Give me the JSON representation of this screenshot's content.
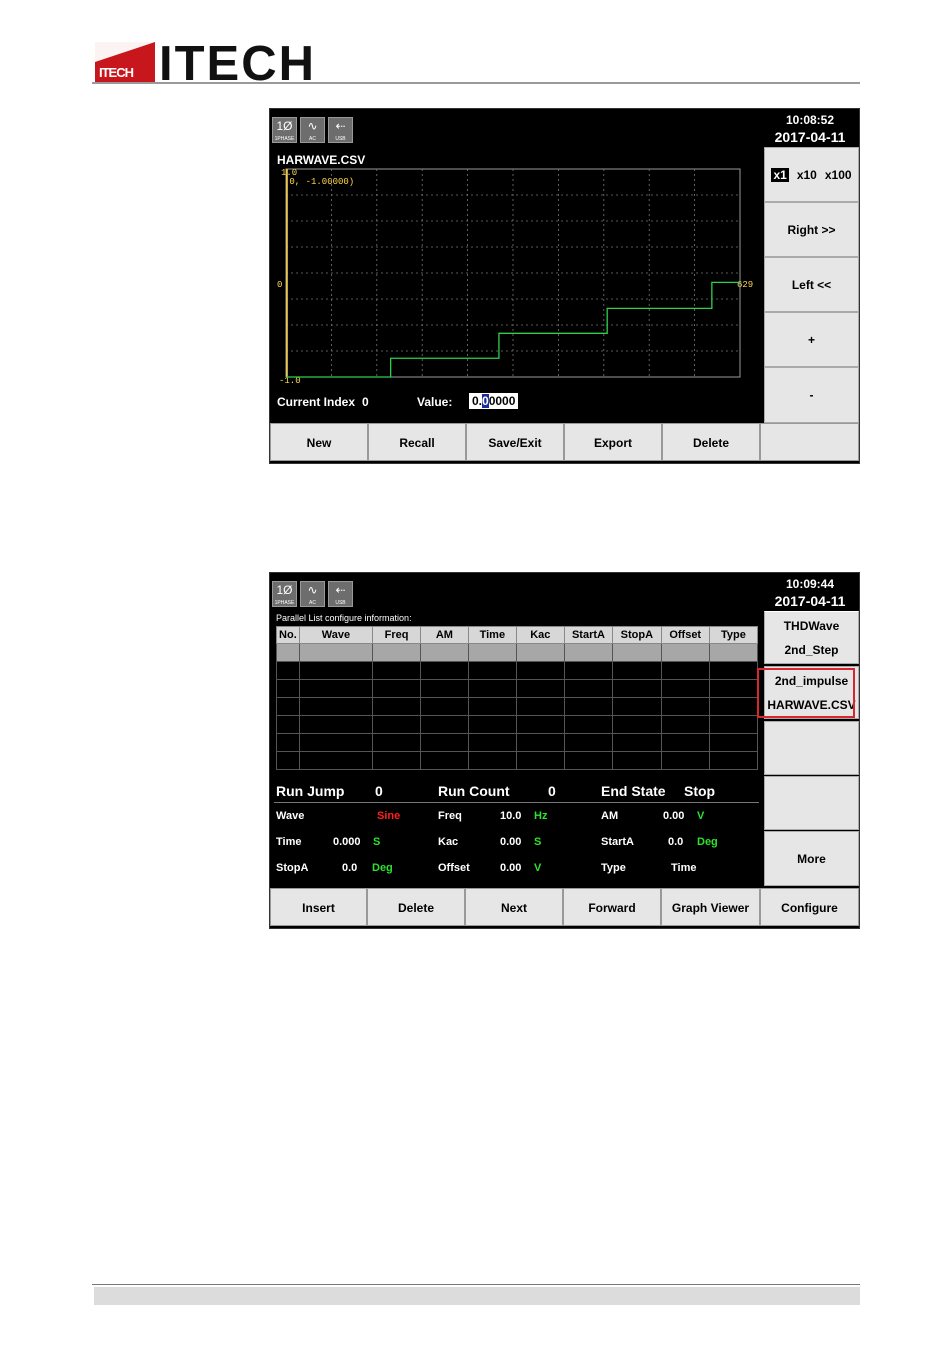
{
  "logo": {
    "small": "ITECH",
    "text": "ITECH"
  },
  "screen1": {
    "icons": [
      {
        "name": "phase-icon",
        "glyph": "1Ø",
        "caption": "1PHASE"
      },
      {
        "name": "ac-wave-icon",
        "glyph": "∿",
        "caption": "AC"
      },
      {
        "name": "usb-icon",
        "glyph": "⇠",
        "caption": "USB"
      }
    ],
    "time": "10:08:52",
    "date": "2017-04-11",
    "file_title": "HARWAVE.CSV",
    "y_top": "1.0",
    "y_mid": "0",
    "y_bottom": "-1.0",
    "cursor_readout": "(0, -1.00000)",
    "x_end_label": "629",
    "current_index_label": "Current Index",
    "current_index_value": "0",
    "value_label": "Value:",
    "value_pre": "0.",
    "value_cursor": "0",
    "value_post": "0000",
    "zoom": {
      "x1": "x1",
      "x10": "x10",
      "x100": "x100"
    },
    "side_buttons": [
      "Right >>",
      "Left <<",
      "+",
      "-"
    ],
    "bottom_buttons": [
      "New",
      "Recall",
      "Save/Exit",
      "Export",
      "Delete",
      ""
    ],
    "chart_data": {
      "type": "line",
      "x": [
        0,
        145,
        145,
        295,
        295,
        445,
        445,
        590,
        590,
        629
      ],
      "y": [
        -1.0,
        -1.0,
        -0.82,
        -0.82,
        -0.58,
        -0.58,
        -0.34,
        -0.34,
        -0.09,
        -0.09
      ],
      "xlim": [
        0,
        629
      ],
      "ylim": [
        -1.0,
        1.0
      ],
      "grid": true,
      "line_color": "#2fcf4a"
    }
  },
  "screen2": {
    "icons": [
      {
        "name": "phase-icon",
        "glyph": "1Ø",
        "caption": "1PHASE"
      },
      {
        "name": "ac-wave-icon",
        "glyph": "∿",
        "caption": "AC"
      },
      {
        "name": "usb-icon",
        "glyph": "⇠",
        "caption": "USB"
      }
    ],
    "time": "10:09:44",
    "date": "2017-04-11",
    "table_title": "Parallel List configure information:",
    "columns": [
      "No.",
      "Wave",
      "Freq",
      "AM",
      "Time",
      "Kac",
      "StartA",
      "StopA",
      "Offset",
      "Type"
    ],
    "rows_count_visible": 7,
    "run_jump_label": "Run Jump",
    "run_jump_value": "0",
    "run_count_label": "Run Count",
    "run_count_value": "0",
    "end_state_label": "End State",
    "end_state_value": "Stop",
    "fields": {
      "wave_label": "Wave",
      "wave_value": "Sine",
      "freq_label": "Freq",
      "freq_value": "10.0",
      "freq_unit": "Hz",
      "am_label": "AM",
      "am_value": "0.00",
      "am_unit": "V",
      "time_label": "Time",
      "time_value": "0.000",
      "time_unit": "S",
      "kac_label": "Kac",
      "kac_value": "0.00",
      "kac_unit": "S",
      "starta_label": "StartA",
      "starta_value": "0.0",
      "starta_unit": "Deg",
      "stopa_label": "StopA",
      "stopa_value": "0.0",
      "stopa_unit": "Deg",
      "offset_label": "Offset",
      "offset_value": "0.00",
      "offset_unit": "V",
      "type_label": "Type",
      "type_value": "Time"
    },
    "side_buttons": {
      "b1_line1": "THDWave",
      "b1_line2": "2nd_Step",
      "b2_line1": "2nd_impulse",
      "b2_line2": "HARWAVE.CSV",
      "b3": "",
      "b4": "",
      "b5": "More"
    },
    "bottom_buttons": [
      "Insert",
      "Delete",
      "Next",
      "Forward",
      "Graph Viewer",
      "Configure"
    ]
  }
}
